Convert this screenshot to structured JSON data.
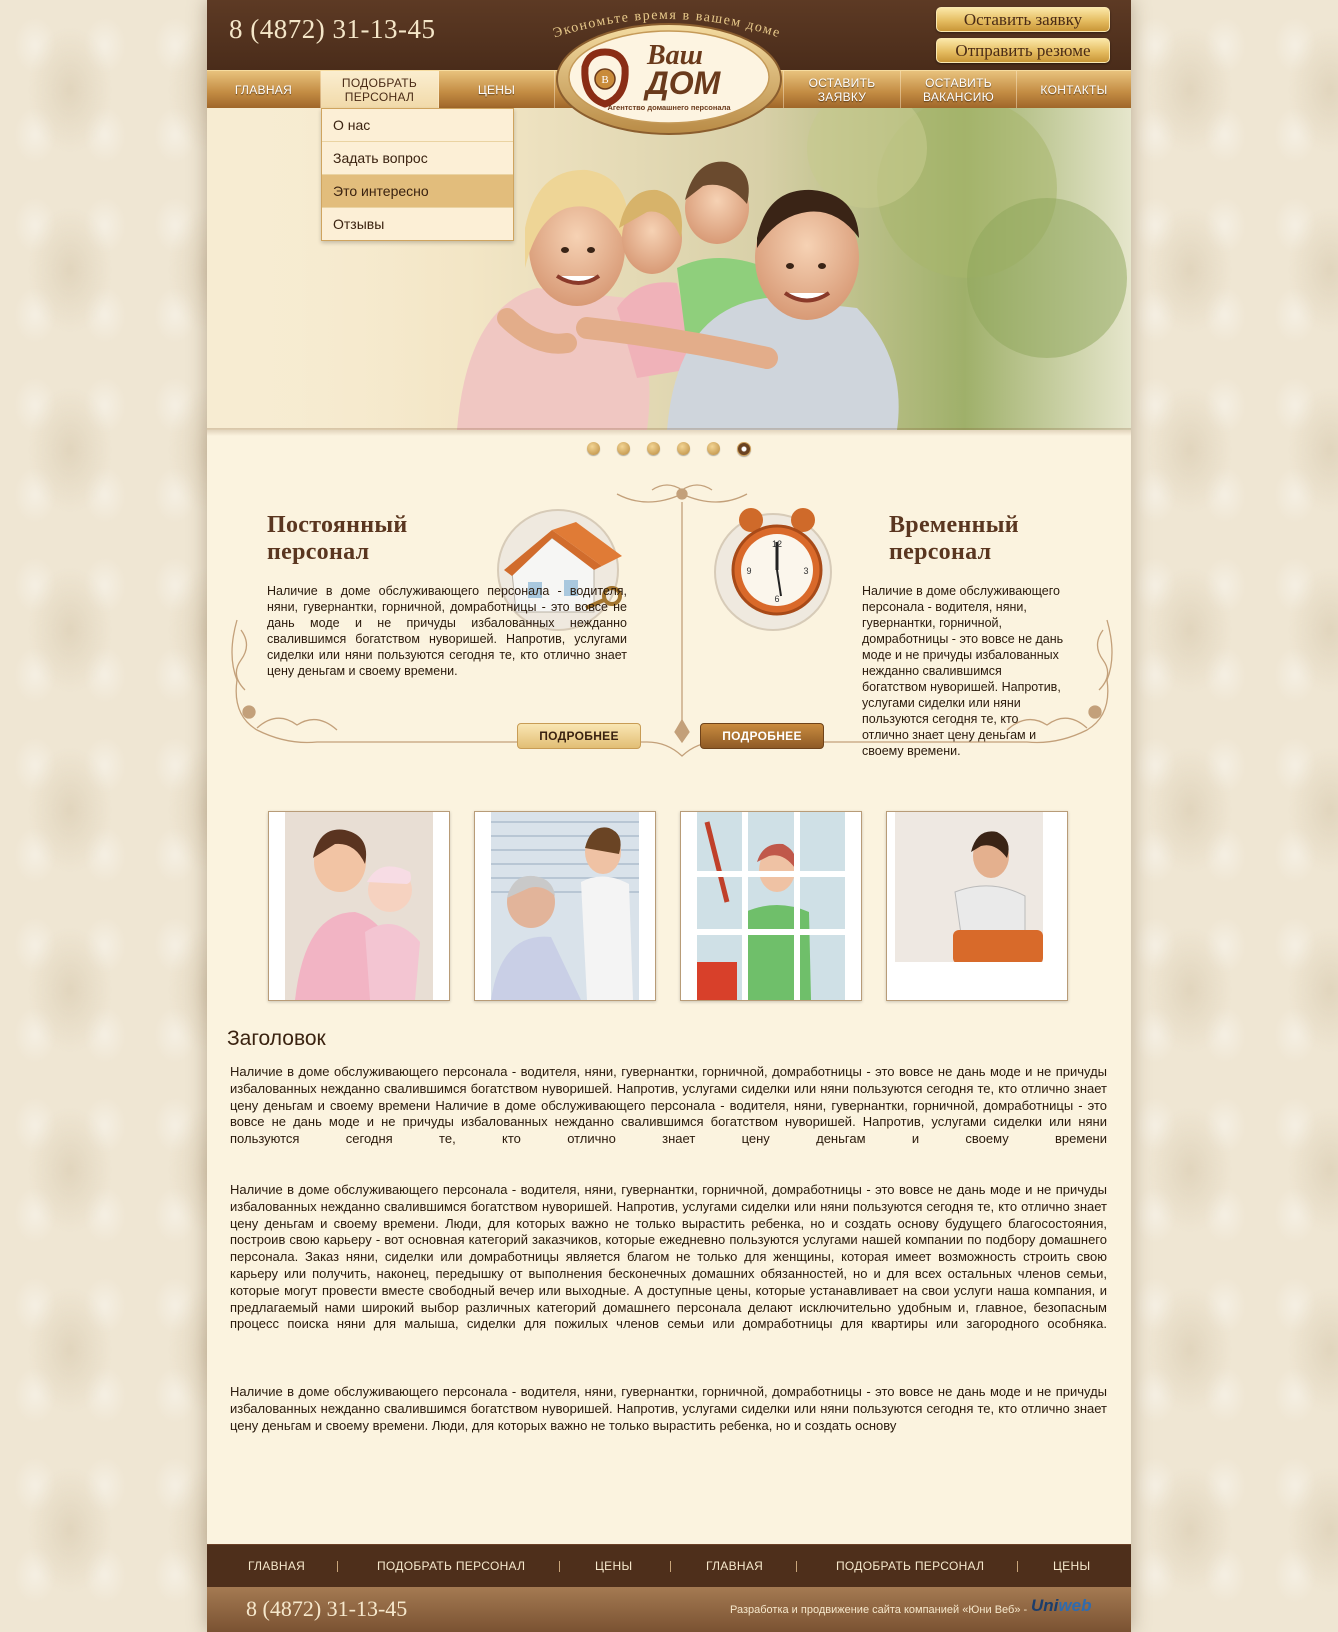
{
  "header": {
    "phone": "8 (4872) 31-13-45",
    "slogan": "Экономьте время в вашем доме",
    "btn_request": "Оставить заявку",
    "btn_resume": "Отправить резюме",
    "logo": {
      "line1": "Ваш",
      "line2": "ДОМ",
      "subtitle": "Агентство домашнего персонала"
    }
  },
  "nav": {
    "items": [
      {
        "label": "ГЛАВНАЯ"
      },
      {
        "label": "ПОДОБРАТЬ ПЕРСОНАЛ"
      },
      {
        "label": "ЦЕНЫ"
      },
      {
        "label": "ОСТАВИТЬ ЗАЯВКУ"
      },
      {
        "label": "ОСТАВИТЬ ВАКАНСИЮ"
      },
      {
        "label": "КОНТАКТЫ"
      }
    ],
    "active_index": 1
  },
  "dropdown": {
    "items": [
      "О нас",
      "Задать вопрос",
      "Это интересно",
      "Отзывы"
    ],
    "highlighted_index": 2
  },
  "slider": {
    "dot_count": 6,
    "active_dot": 5
  },
  "permanent": {
    "title": "Постоянный персонал",
    "title_line1": "Постоянный",
    "title_line2": "персонал",
    "text": "Наличие в доме обслуживающего персонала - водителя, няни, гувернантки, горничной, домработницы - это вовсе не дань моде и не причуды избалованных нежданно свалившимся богатством нуворишей. Напротив, услугами сиделки или няни пользуются сегодня те, кто отлично знает цену деньгам и своему времени.",
    "button": "ПОДРОБНЕЕ",
    "icon": "house-key-icon"
  },
  "temporary": {
    "title_line1": "Временный",
    "title_line2": "персонал",
    "text": "Наличие в доме обслуживающего персонала - водителя, няни, гувернантки, горничной, домработницы - это вовсе не дань моде и не причуды избалованных нежданно свалившимся богатством нуворишей. Напротив, услугами сиделки или няни пользуются сегодня те, кто отлично знает цену деньгам и своему времени.",
    "button": "ПОДРОБНЕЕ",
    "icon": "alarm-clock-icon"
  },
  "content": {
    "heading": "Заголовок",
    "p1": "Наличие в доме обслуживающего персонала - водителя, няни, гувернантки, горничной, домработницы - это вовсе не дань моде и не причуды избалованных нежданно свалившимся богатством нуворишей. Напротив, услугами сиделки или няни пользуются сегодня те, кто отлично знает цену деньгам и своему времени Наличие в доме обслуживающего персонала - водителя, няни, гувернантки, горничной, домработницы - это вовсе не дань моде и не причуды избалованных нежданно свалившимся богатством нуворишей. Напротив, услугами сиделки или няни пользуются сегодня те, кто отлично знает цену деньгам и своему времени",
    "p2": "Наличие в доме обслуживающего персонала - водителя, няни, гувернантки, горничной, домработницы - это вовсе не дань моде и не причуды избалованных нежданно свалившимся богатством нуворишей. Напротив, услугами сиделки или няни пользуются сегодня те, кто отлично знает цену деньгам и своему времени. Люди, для которых важно не только вырастить ребенка, но и создать основу будущего благосостояния, построив свою карьеру - вот основная категорий заказчиков, которые ежедневно пользуются услугами нашей компании по подбору домашнего персонала. Заказ няни, сиделки или домработницы является благом не только для женщины, которая имеет возможность строить свою карьеру или получить, наконец, передышку от выполнения бесконечных домашних обязанностей, но и для всех остальных членов семьи, которые могут провести вместе свободный вечер или выходные. А доступные цены, которые устанавливает на свои услуги наша компания, и предлагаемый нами широкий выбор различных категорий домашнего персонала делают исключительно удобным и, главное, безопасным процесс поиска няни для малыша, сиделки для пожилых членов семьи или домработницы для квартиры или загородного особняка.",
    "p3": "Наличие в доме обслуживающего персонала - водителя, няни, гувернантки, горничной, домработницы - это вовсе не дань моде и не причуды избалованных нежданно свалившимся богатством нуворишей. Напротив, услугами сиделки или няни пользуются сегодня те, кто отлично знает цену деньгам и своему времени. Люди, для которых важно не только вырастить ребенка, но и создать основу"
  },
  "footer": {
    "nav": [
      "ГЛАВНАЯ",
      "ПОДОБРАТЬ ПЕРСОНАЛ",
      "ЦЕНЫ",
      "ГЛАВНАЯ",
      "ПОДОБРАТЬ ПЕРСОНАЛ",
      "ЦЕНЫ"
    ],
    "phone": "8 (4872) 31-13-45",
    "credit": "Разработка и продвижение сайта компанией «Юни Веб» -",
    "uniweb_a": "Uni",
    "uniweb_b": "web"
  },
  "colors": {
    "brown_dark": "#4e2f1b",
    "gold": "#e2be75",
    "cream": "#fbf3df"
  }
}
